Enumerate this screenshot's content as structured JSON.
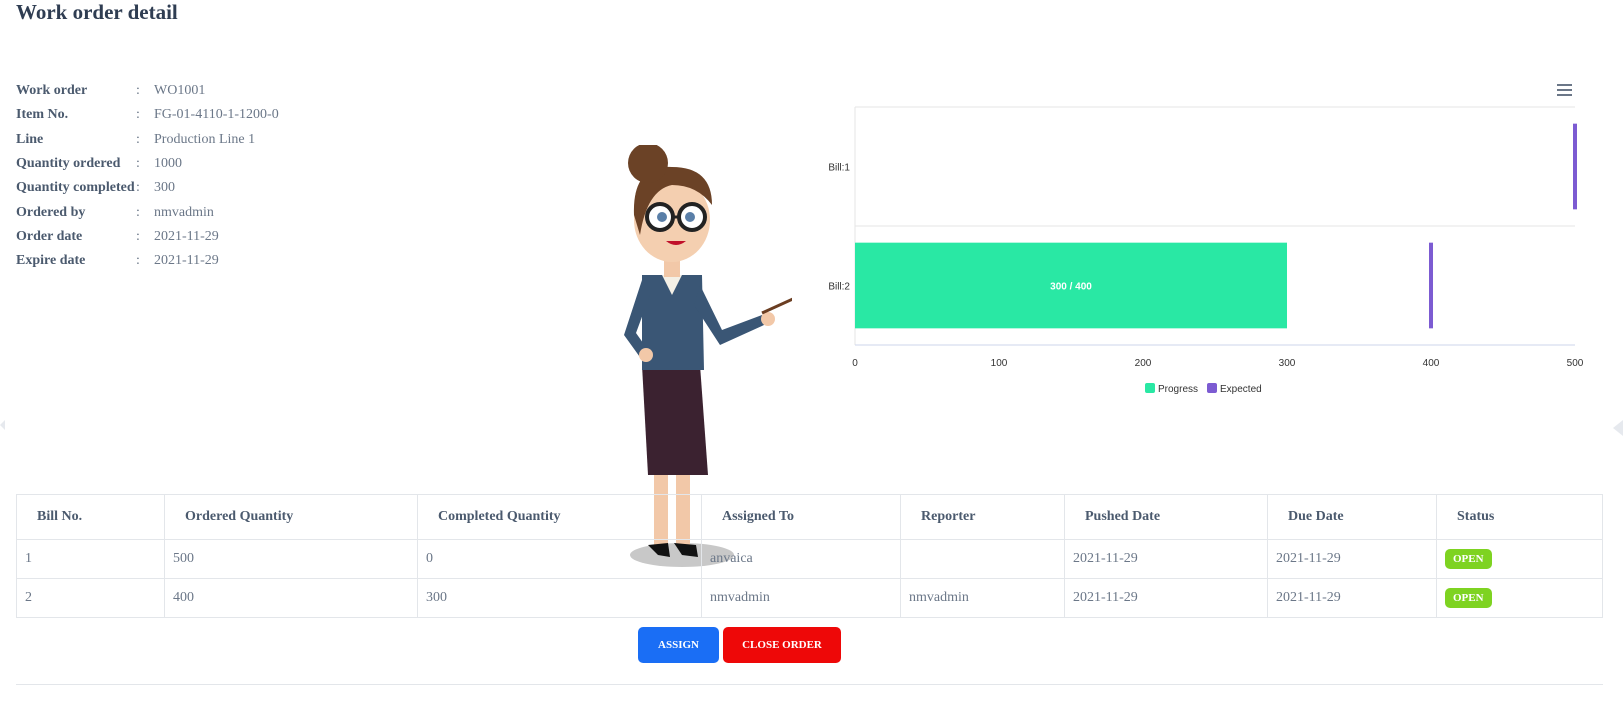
{
  "page_title": "Work order detail",
  "details": [
    {
      "label": "Work order",
      "value": "WO1001"
    },
    {
      "label": "Item No.",
      "value": "FG-01-4110-1-1200-0"
    },
    {
      "label": "Line",
      "value": "Production Line 1"
    },
    {
      "label": "Quantity ordered",
      "value": "1000"
    },
    {
      "label": "Quantity completed",
      "value": "300"
    },
    {
      "label": "Ordered by",
      "value": "nmvadmin"
    },
    {
      "label": "Order date",
      "value": "2021-11-29"
    },
    {
      "label": "Expire date",
      "value": "2021-11-29"
    }
  ],
  "separator": ":",
  "chart_menu_icon": "hamburger-menu-icon",
  "chart_data": {
    "type": "bar",
    "orientation": "horizontal",
    "categories": [
      "Bill:1",
      "Bill:2"
    ],
    "series": [
      {
        "name": "Progress",
        "values": [
          0,
          300
        ],
        "color": "#29e8a4"
      },
      {
        "name": "Expected",
        "values": [
          500,
          400
        ],
        "color": "#7c5bd2"
      }
    ],
    "data_labels": [
      "",
      "300 / 400"
    ],
    "xlim": [
      0,
      500
    ],
    "x_ticks": [
      "0",
      "100",
      "200",
      "300",
      "400",
      "500"
    ],
    "legend": "bottom-center"
  },
  "table": {
    "headers": [
      "Bill No.",
      "Ordered Quantity",
      "Completed Quantity",
      "Assigned To",
      "Reporter",
      "Pushed Date",
      "Due Date",
      "Status"
    ],
    "rows": [
      [
        "1",
        "500",
        "0",
        "anvaica",
        "",
        "2021-11-29",
        "2021-11-29",
        "OPEN"
      ],
      [
        "2",
        "400",
        "300",
        "nmvadmin",
        "nmvadmin",
        "2021-11-29",
        "2021-11-29",
        "OPEN"
      ]
    ],
    "status_color": "#7ed321"
  },
  "buttons": {
    "assign_label": "ASSIGN",
    "close_label": "CLOSE ORDER",
    "assign_color": "#1a6ef5",
    "close_color": "#ee0808"
  }
}
